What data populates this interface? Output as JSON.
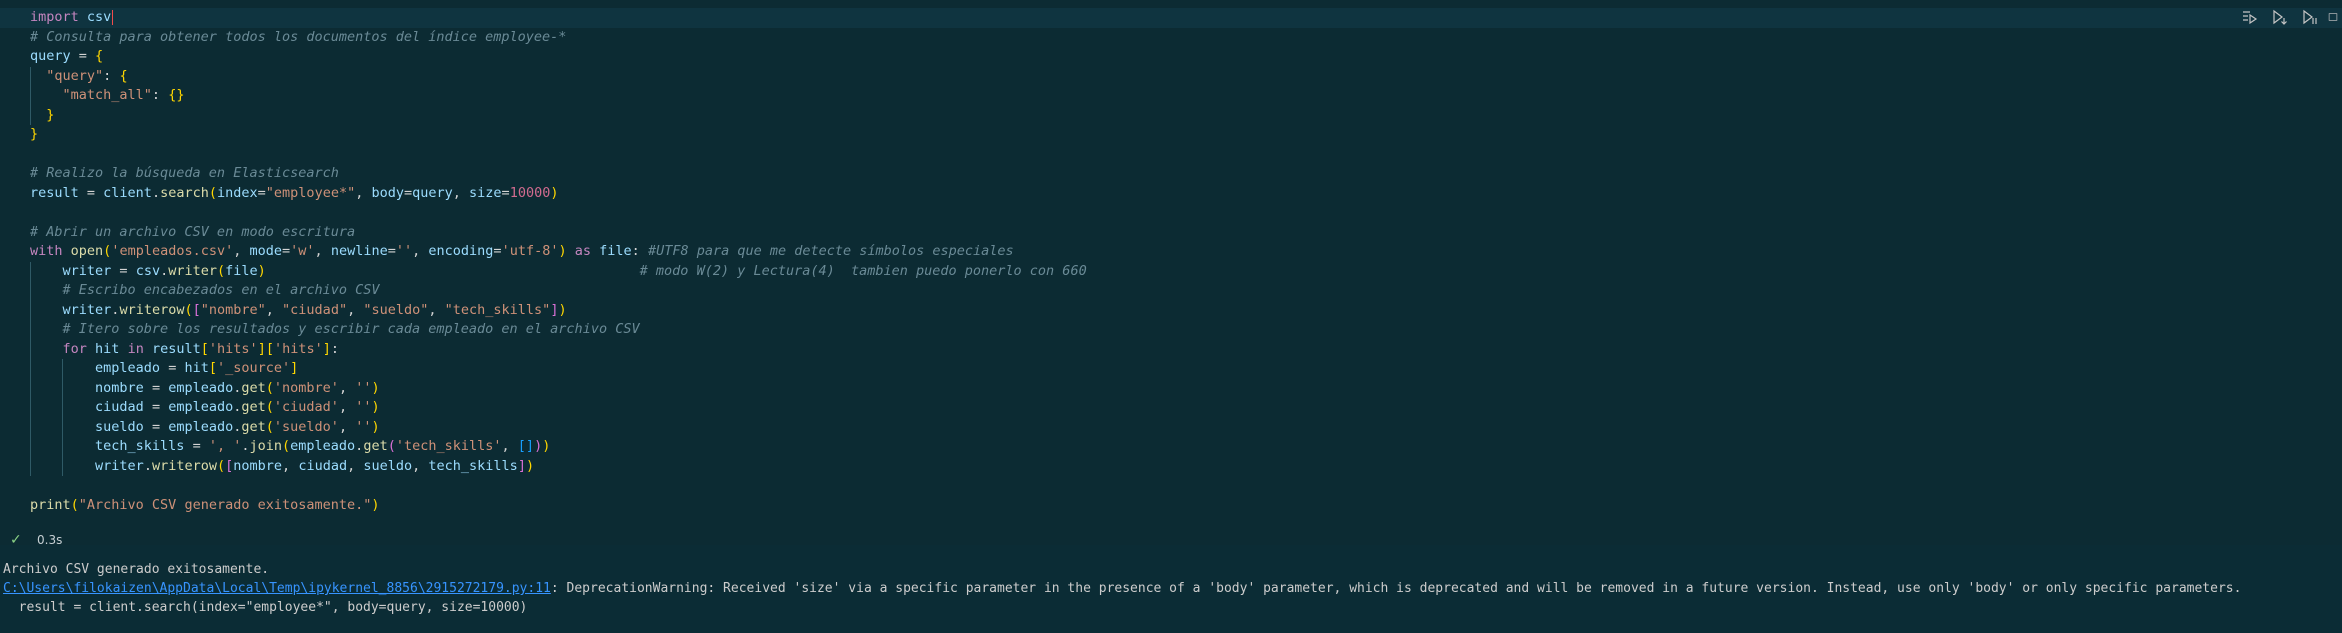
{
  "toolbar": {
    "buttons": [
      "execute-above-cells",
      "execute-cell-and-below",
      "execute-cell",
      "split-cell"
    ]
  },
  "code_lines": [
    "import csv",
    "# Consulta para obtener todos los documentos del índice employee-*",
    "query = {",
    "  \"query\": {",
    "    \"match_all\": {}",
    "  }",
    "}",
    "",
    "# Realizo la búsqueda en Elasticsearch",
    "result = client.search(index=\"employee*\", body=query, size=10000)",
    "",
    "# Abrir un archivo CSV en modo escritura",
    "with open('empleados.csv', mode='w', newline='', encoding='utf-8') as file: #UTF8 para que me detecte símbolos especiales",
    "    writer = csv.writer(file)                                              # modo W(2) y Lectura(4)  tambien puedo ponerlo con 660",
    "    # Escribo encabezados en el archivo CSV",
    "    writer.writerow([\"nombre\", \"ciudad\", \"sueldo\", \"tech_skills\"])",
    "    # Itero sobre los resultados y escribir cada empleado en el archivo CSV",
    "    for hit in result['hits']['hits']:",
    "        empleado = hit['_source']",
    "        nombre = empleado.get('nombre', '')",
    "        ciudad = empleado.get('ciudad', '')",
    "        sueldo = empleado.get('sueldo', '')",
    "        tech_skills = ', '.join(empleado.get('tech_skills', []))",
    "        writer.writerow([nombre, ciudad, sueldo, tech_skills])",
    "",
    "print(\"Archivo CSV generado exitosamente.\")"
  ],
  "status": {
    "check": "✓",
    "time": "0.3s"
  },
  "output": {
    "line1": "Archivo CSV generado exitosamente.",
    "link": "C:\\Users\\filokaizen\\AppData\\Local\\Temp\\ipykernel_8856\\2915272179.py:11",
    "warning": ": DeprecationWarning: Received 'size' via a specific parameter in the presence of a 'body' parameter, which is deprecated and will be removed in a future version. Instead, use only 'body' or only specific parameters.",
    "line3": "  result = client.search(index=\"employee*\", body=query, size=10000)"
  }
}
